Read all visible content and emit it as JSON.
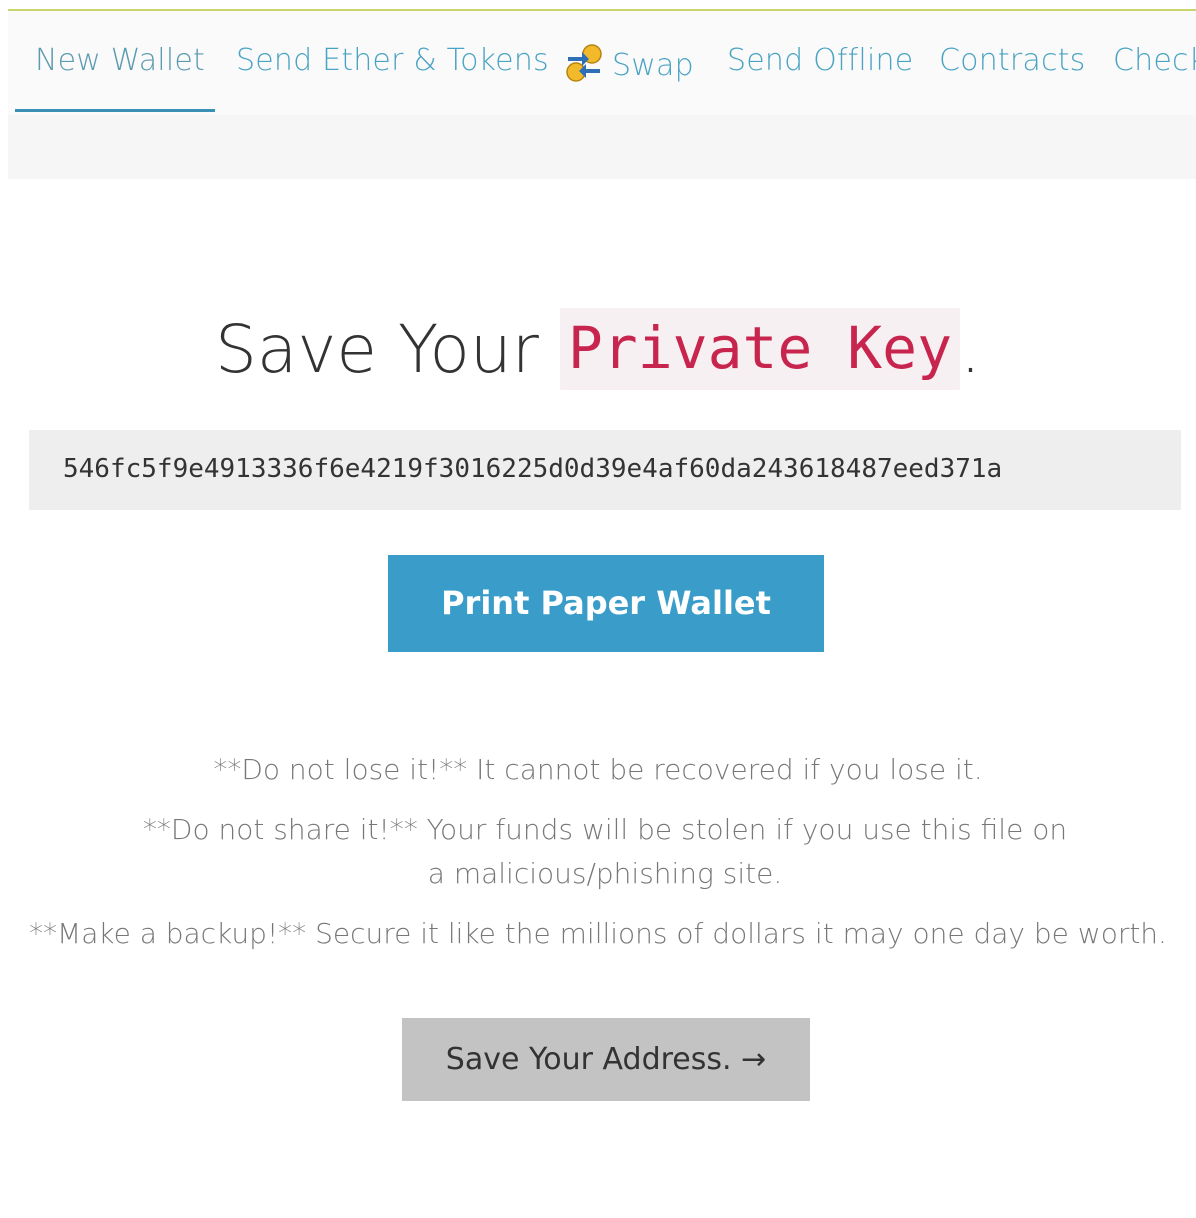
{
  "nav": {
    "tabs": [
      {
        "label": "New Wallet",
        "active": true
      },
      {
        "label": "Send Ether & Tokens"
      },
      {
        "label": "Swap",
        "icon": "swap-icon"
      },
      {
        "label": "Send Offline"
      },
      {
        "label": "Contracts"
      },
      {
        "label": "Check"
      }
    ]
  },
  "main": {
    "title_prefix": "Save Your",
    "title_code": "Private Key",
    "title_suffix": ".",
    "private_key": "546fc5f9e4913336f6e4219f3016225d0d39e4af60da243618487eed371a",
    "print_button": "Print Paper Wallet",
    "warnings": [
      "**Do not lose it!** It cannot be recovered if you lose it.",
      "**Do not share it!** Your funds will be stolen if you use this file on a malicious/phishing site.",
      "**Make a backup!** Secure it like the millions of dollars it may one day be worth."
    ],
    "next_button": "Save Your Address. →"
  },
  "colors": {
    "accent": "#3a9dc9",
    "tab_text": "#4aa3c3",
    "code_text": "#c7254e",
    "top_border": "#c9d46a"
  }
}
